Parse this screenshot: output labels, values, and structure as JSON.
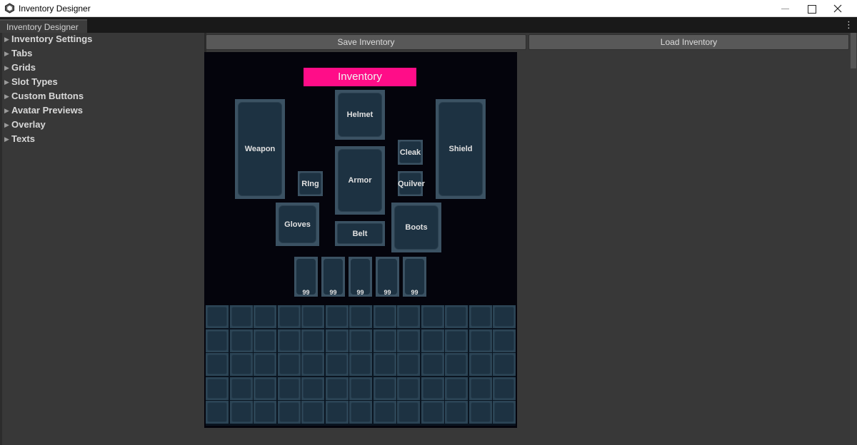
{
  "window": {
    "title": "Inventory Designer",
    "tab_label": "Inventory Designer",
    "menu_glyph": "⋮"
  },
  "inspector": {
    "items": [
      {
        "label": "Inventory Settings",
        "name": "foldout-inventory-settings"
      },
      {
        "label": "Tabs",
        "name": "foldout-tabs"
      },
      {
        "label": "Grids",
        "name": "foldout-grids"
      },
      {
        "label": "Slot Types",
        "name": "foldout-slot-types"
      },
      {
        "label": "Custom Buttons",
        "name": "foldout-custom-buttons"
      },
      {
        "label": "Avatar Previews",
        "name": "foldout-avatar-previews"
      },
      {
        "label": "Overlay",
        "name": "foldout-overlay"
      },
      {
        "label": "Texts",
        "name": "foldout-texts"
      }
    ]
  },
  "toolbar": {
    "save_label": "Save Inventory",
    "load_label": "Load Inventory"
  },
  "canvas": {
    "title": "Inventory",
    "title_color": "#ff0d88",
    "equipment": {
      "weapon": "Weapon",
      "helmet": "Helmet",
      "shield": "Shield",
      "cloak": "Cleak",
      "ring": "RIng",
      "armor": "Armor",
      "quiver": "Quilver",
      "gloves": "Gloves",
      "boots": "Boots",
      "belt": "Belt"
    },
    "quickbar": [
      "99",
      "99",
      "99",
      "99",
      "99"
    ],
    "grid": {
      "columns": 13,
      "rows": 5
    }
  }
}
